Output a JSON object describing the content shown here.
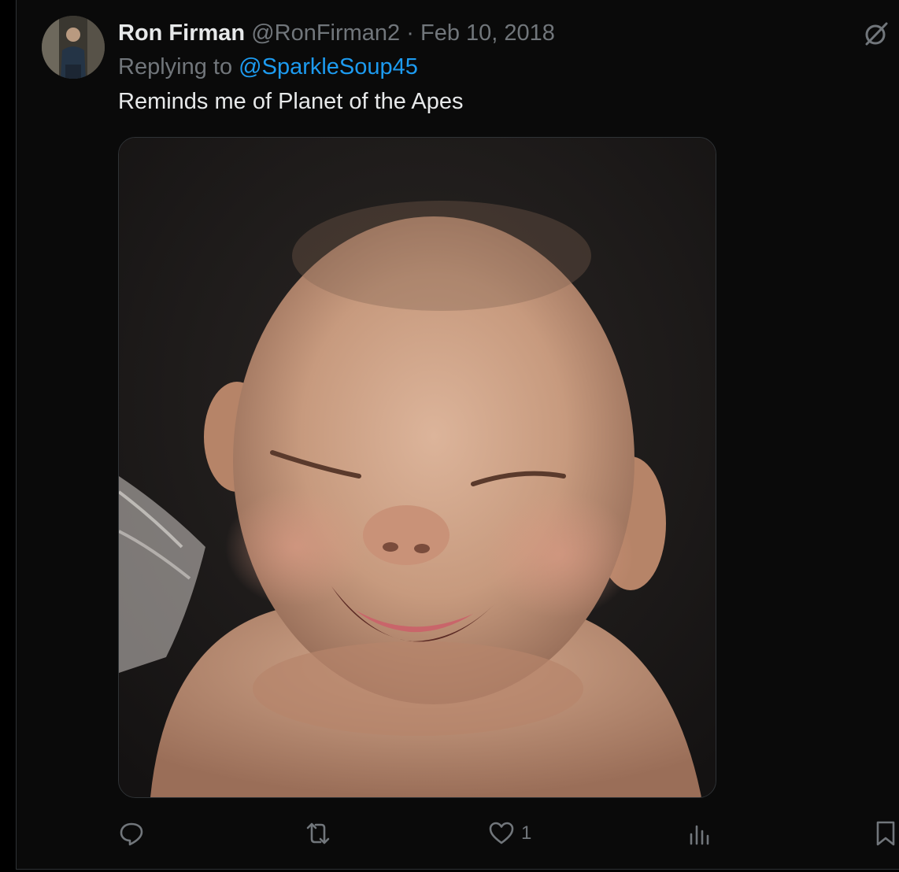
{
  "tweet": {
    "author_name": "Ron Firman",
    "author_handle": "@RonFirman2",
    "separator": "·",
    "date": "Feb 10, 2018",
    "replying_prefix": "Replying to",
    "replying_to": "@SparkleSoup45",
    "text": "Reminds me of Planet of the Apes",
    "media": {
      "description_icon": "photo-laughing-baby"
    }
  },
  "actions": {
    "reply": {
      "icon": "reply-icon",
      "count": ""
    },
    "repost": {
      "icon": "repost-icon",
      "count": ""
    },
    "like": {
      "icon": "heart-icon",
      "count": "1"
    },
    "views": {
      "icon": "views-icon",
      "count": ""
    },
    "bookmark": {
      "icon": "bookmark-icon",
      "count": ""
    }
  },
  "colors": {
    "background": "#000000",
    "text_primary": "#e7e9ea",
    "text_secondary": "#71767b",
    "accent": "#1d9bf0",
    "border": "#2f3336"
  }
}
